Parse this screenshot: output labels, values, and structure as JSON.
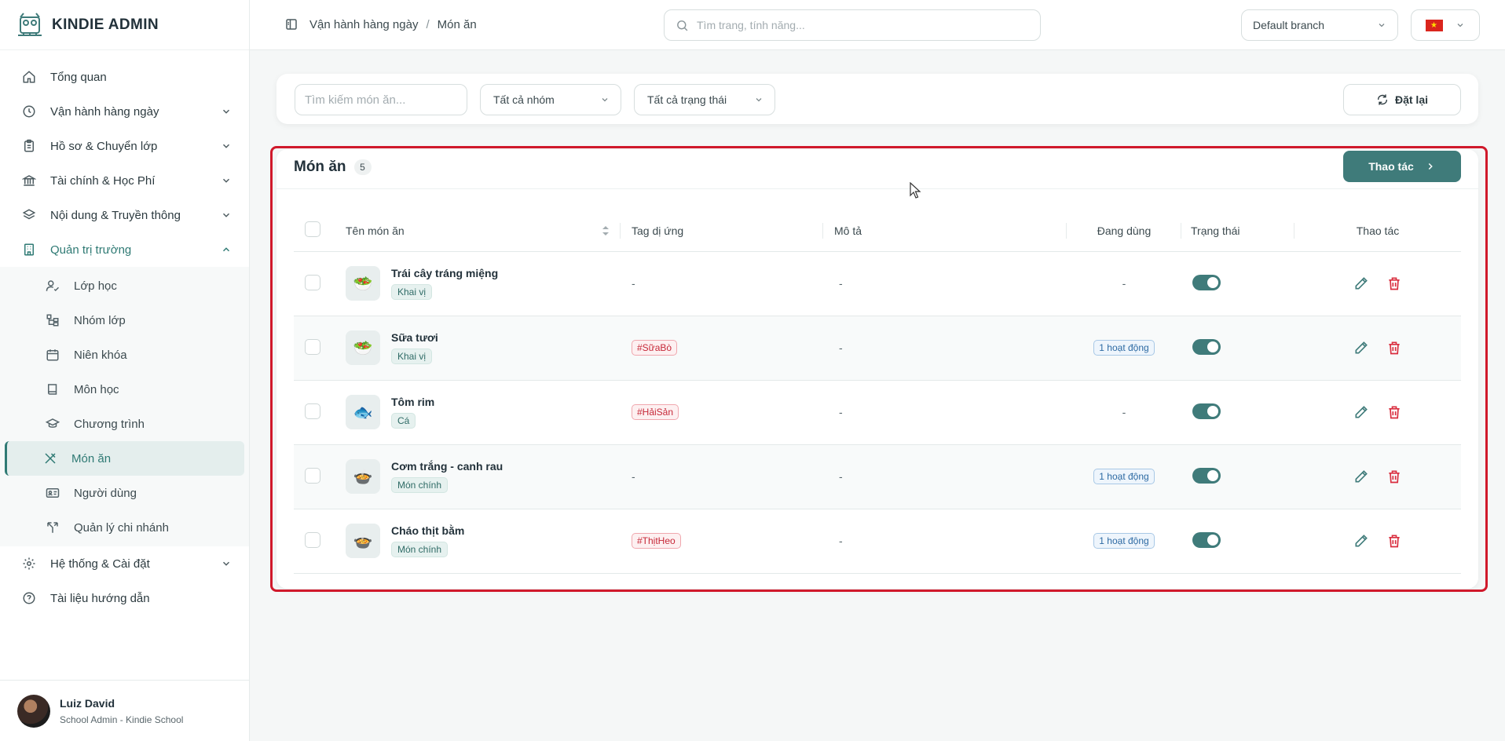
{
  "brand": {
    "name": "KINDIE ADMIN"
  },
  "nav": {
    "items": [
      {
        "label": "Tổng quan",
        "icon": "home-icon"
      },
      {
        "label": "Vận hành hàng ngày",
        "icon": "clock-icon"
      },
      {
        "label": "Hồ sơ & Chuyển lớp",
        "icon": "clipboard-icon"
      },
      {
        "label": "Tài chính & Học Phí",
        "icon": "bank-icon"
      },
      {
        "label": "Nội dung & Truyền thông",
        "icon": "layers-icon"
      },
      {
        "label": "Quản trị trường",
        "icon": "building-icon"
      }
    ],
    "sub_items": [
      {
        "label": "Lớp học",
        "icon": "user-check-icon"
      },
      {
        "label": "Nhóm lớp",
        "icon": "hierarchy-icon"
      },
      {
        "label": "Niên khóa",
        "icon": "calendar-icon"
      },
      {
        "label": "Môn học",
        "icon": "book-icon"
      },
      {
        "label": "Chương trình",
        "icon": "graduation-cap-icon"
      },
      {
        "label": "Món ăn",
        "icon": "utensils-icon"
      },
      {
        "label": "Người dùng",
        "icon": "id-card-icon"
      },
      {
        "label": "Quản lý chi nhánh",
        "icon": "branch-icon"
      }
    ],
    "bottom_items": [
      {
        "label": "Hệ thống & Cài đặt",
        "icon": "gear-icon"
      },
      {
        "label": "Tài liệu hướng dẫn",
        "icon": "help-circle-icon"
      }
    ]
  },
  "user": {
    "name": "Luiz David",
    "role": "School Admin - Kindie School"
  },
  "topbar": {
    "breadcrumb": [
      "Vận hành hàng ngày",
      "Món ăn"
    ],
    "breadcrumb_sep": "/",
    "search_placeholder": "Tìm trang, tính năng...",
    "branch": "Default branch"
  },
  "filters": {
    "search_placeholder": "Tìm kiếm món ăn...",
    "group_select": "Tất cả nhóm",
    "status_select": "Tất cả trạng thái",
    "reset_label": "Đặt lại"
  },
  "card": {
    "title": "Món ăn",
    "count": "5",
    "action_label": "Thao tác"
  },
  "table": {
    "headers": {
      "name": "Tên món ăn",
      "allergy": "Tag dị ứng",
      "desc": "Mô tả",
      "usage": "Đang dùng",
      "status": "Trạng thái",
      "actions": "Thao tác"
    },
    "rows": [
      {
        "name": "Trái cây tráng miệng",
        "category": "Khai vị",
        "emoji": "🥗",
        "allergy": "-",
        "desc": "-",
        "usage": "-",
        "active": true
      },
      {
        "name": "Sữa tươi",
        "category": "Khai vị",
        "emoji": "🥗",
        "allergy": "#SữaBò",
        "desc": "-",
        "usage": "1 hoạt động",
        "active": true
      },
      {
        "name": "Tôm rim",
        "category": "Cá",
        "emoji": "🐟",
        "allergy": "#HảiSản",
        "desc": "-",
        "usage": "-",
        "active": true
      },
      {
        "name": "Cơm trắng - canh rau",
        "category": "Món chính",
        "emoji": "🍲",
        "allergy": "-",
        "desc": "-",
        "usage": "1 hoạt động",
        "active": true
      },
      {
        "name": "Cháo thịt bằm",
        "category": "Món chính",
        "emoji": "🍲",
        "allergy": "#ThịtHeo",
        "desc": "-",
        "usage": "1 hoạt động",
        "active": true
      }
    ]
  },
  "colors": {
    "accent": "#3f7b7a",
    "danger": "#d92d3e",
    "highlight": "#d0192b"
  }
}
